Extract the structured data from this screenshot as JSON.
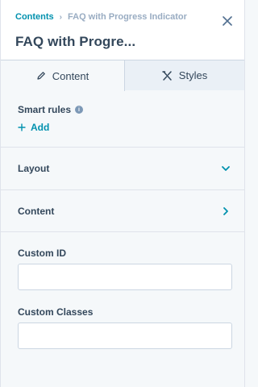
{
  "breadcrumb": {
    "parent": "Contents",
    "current": "FAQ with Progress Indicator"
  },
  "header": {
    "title": "FAQ with Progre..."
  },
  "tabs": [
    {
      "label": "Content",
      "icon": "pencil-icon",
      "active": true
    },
    {
      "label": "Styles",
      "icon": "styles-icon",
      "active": false
    }
  ],
  "smart_rules": {
    "label": "Smart rules",
    "add_label": "Add"
  },
  "sections": [
    {
      "label": "Layout",
      "icon": "chevron-down-icon"
    },
    {
      "label": "Content",
      "icon": "chevron-right-icon"
    }
  ],
  "fields": {
    "custom_id": {
      "label": "Custom ID",
      "value": "",
      "placeholder": ""
    },
    "custom_classes": {
      "label": "Custom Classes",
      "value": "",
      "placeholder": ""
    }
  },
  "colors": {
    "accent": "#0091ae",
    "text": "#33475b",
    "muted": "#99acc2",
    "border": "#cbd6e2",
    "panel_bg": "#f5f8fa"
  }
}
